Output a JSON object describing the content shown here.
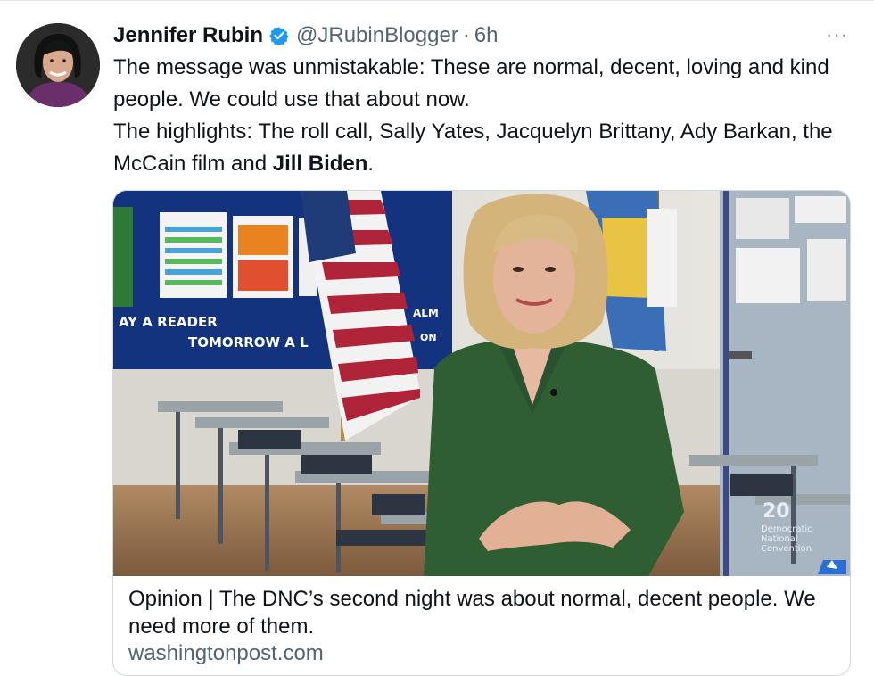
{
  "tweet": {
    "author_name": "Jennifer Rubin",
    "handle": "@JRubinBlogger",
    "separator": "·",
    "time": "6h",
    "more_label": "···",
    "text_line_1": "The message was unmistakable: These are normal, decent, loving and kind people. We could use that about now.",
    "text_line_2_prefix": "The highlights: The roll call, Sally Yates, Jacquelyn Brittany, Ady Barkan, the McCain film and ",
    "text_line_2_bold": "Jill Biden",
    "text_line_2_suffix": "."
  },
  "card": {
    "title": "Opinion | The DNC’s second night was about normal, decent people. We need more of them.",
    "domain": "washingtonpost.com",
    "image": {
      "board_text_1": "AY A READER",
      "board_text_2": "TOMORROW A L",
      "board_text_3": "ALM",
      "board_text_4": "ON",
      "logo_year": "20",
      "logo_line_1": "Democratic",
      "logo_line_2": "National",
      "logo_line_3": "Convention"
    }
  },
  "colors": {
    "text": "#0f1419",
    "secondary": "#536471",
    "verified": "#1d9bf0",
    "border": "#cfd9de"
  },
  "icons": {
    "verified": "verified-badge-icon",
    "more": "more-dots-icon"
  }
}
